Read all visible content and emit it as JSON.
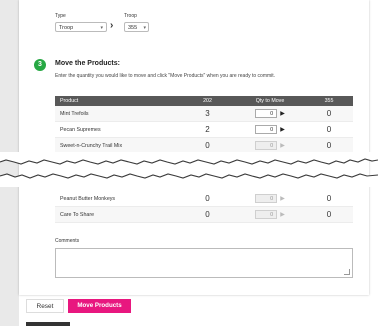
{
  "transfer": {
    "type_label": "Type",
    "type_value": "Troop",
    "troop_label": "Troop",
    "troop_value": "355"
  },
  "step": {
    "number": "3",
    "title": "Move the Products:",
    "description": "Enter the quantity you would like to move and click \"Move Products\" when you are ready to commit."
  },
  "table": {
    "headers": [
      "Product",
      "202",
      "Qty to Move",
      "355"
    ],
    "rows_top": [
      {
        "product": "Mint Trefoils",
        "from": "3",
        "qty": "0",
        "to": "0"
      },
      {
        "product": "Pecan Supremes",
        "from": "2",
        "qty": "0",
        "to": "0"
      },
      {
        "product": "Sweet-n-Crunchy Trail Mix",
        "from": "0",
        "qty": "0",
        "to": "0"
      }
    ],
    "rows_bottom": [
      {
        "product": "Peanut Butter Monkeys",
        "from": "0",
        "qty": "0",
        "to": "0"
      },
      {
        "product": "Care To Share",
        "from": "0",
        "qty": "0",
        "to": "0"
      }
    ]
  },
  "comments_label": "Comments",
  "buttons": {
    "reset": "Reset",
    "move": "Move Products"
  },
  "colors": {
    "step_badge": "#27a844",
    "primary_button": "#e8177f",
    "table_header": "#585858"
  }
}
